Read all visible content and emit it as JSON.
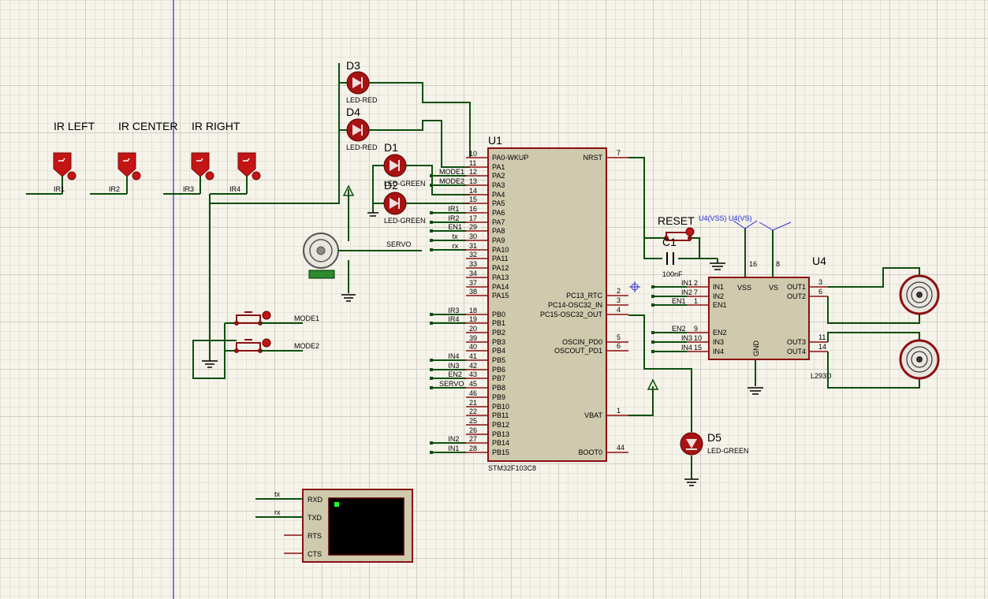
{
  "sensors": {
    "headers": [
      "IR LEFT",
      "IR CENTER",
      "IR RIGHT"
    ],
    "labels": [
      "IR1",
      "IR2",
      "IR3",
      "IR4"
    ]
  },
  "leds": {
    "d3": {
      "ref": "D3",
      "type": "LED-RED"
    },
    "d4": {
      "ref": "D4",
      "type": "LED-RED"
    },
    "d1": {
      "ref": "D1",
      "type": "LED-GREEN"
    },
    "d2": {
      "ref": "D2",
      "type": "LED-GREEN"
    },
    "d5": {
      "ref": "D5",
      "type": "LED-GREEN"
    }
  },
  "servo": {
    "net": "SERVO"
  },
  "buttons": {
    "mode1": "MODE1",
    "mode2": "MODE2",
    "reset": "RESET"
  },
  "mcu": {
    "ref": "U1",
    "part": "STM32F103C8",
    "left_pins": [
      {
        "num": "10",
        "name": "PA0-WKUP",
        "net": ""
      },
      {
        "num": "11",
        "name": "PA1",
        "net": ""
      },
      {
        "num": "12",
        "name": "PA2",
        "net": "MODE1"
      },
      {
        "num": "13",
        "name": "PA3",
        "net": "MODE2"
      },
      {
        "num": "14",
        "name": "PA4",
        "net": ""
      },
      {
        "num": "15",
        "name": "PA5",
        "net": ""
      },
      {
        "num": "16",
        "name": "PA6",
        "net": "IR1"
      },
      {
        "num": "17",
        "name": "PA7",
        "net": "IR2"
      },
      {
        "num": "29",
        "name": "PA8",
        "net": "EN1"
      },
      {
        "num": "30",
        "name": "PA9",
        "net": "tx"
      },
      {
        "num": "31",
        "name": "PA10",
        "net": "rx"
      },
      {
        "num": "32",
        "name": "PA11",
        "net": ""
      },
      {
        "num": "33",
        "name": "PA12",
        "net": ""
      },
      {
        "num": "34",
        "name": "PA13",
        "net": ""
      },
      {
        "num": "37",
        "name": "PA14",
        "net": ""
      },
      {
        "num": "38",
        "name": "PA15",
        "net": ""
      },
      {
        "num": "18",
        "name": "PB0",
        "net": "IR3"
      },
      {
        "num": "19",
        "name": "PB1",
        "net": "IR4"
      },
      {
        "num": "20",
        "name": "PB2",
        "net": ""
      },
      {
        "num": "39",
        "name": "PB3",
        "net": ""
      },
      {
        "num": "40",
        "name": "PB4",
        "net": ""
      },
      {
        "num": "41",
        "name": "PB5",
        "net": "IN4"
      },
      {
        "num": "42",
        "name": "PB6",
        "net": "IN3"
      },
      {
        "num": "43",
        "name": "PB7",
        "net": "EN2"
      },
      {
        "num": "45",
        "name": "PB8",
        "net": "SERVO"
      },
      {
        "num": "46",
        "name": "PB9",
        "net": ""
      },
      {
        "num": "21",
        "name": "PB10",
        "net": ""
      },
      {
        "num": "22",
        "name": "PB11",
        "net": ""
      },
      {
        "num": "25",
        "name": "PB12",
        "net": ""
      },
      {
        "num": "26",
        "name": "PB13",
        "net": ""
      },
      {
        "num": "27",
        "name": "PB14",
        "net": "IN2"
      },
      {
        "num": "28",
        "name": "PB15",
        "net": "IN1"
      }
    ],
    "right_pins": [
      {
        "num": "7",
        "name": "NRST"
      },
      {
        "num": "2",
        "name": "PC13_RTC"
      },
      {
        "num": "3",
        "name": "PC14-OSC32_IN"
      },
      {
        "num": "4",
        "name": "PC15-OSC32_OUT"
      },
      {
        "num": "5",
        "name": "OSCIN_PD0"
      },
      {
        "num": "6",
        "name": "OSCOUT_PD1"
      },
      {
        "num": "1",
        "name": "VBAT"
      },
      {
        "num": "44",
        "name": "BOOT0"
      }
    ]
  },
  "capacitor": {
    "ref": "C1",
    "value": "100nF"
  },
  "driver": {
    "ref": "U4",
    "part": "L293D",
    "power_labels": "U4(VSS)  U4(VS)",
    "vss_pin": "16",
    "vs_pin": "8",
    "vss": "VSS",
    "vs": "VS",
    "gnd": "GND",
    "left_pins": [
      {
        "num": "2",
        "name": "IN1",
        "net": "IN1"
      },
      {
        "num": "7",
        "name": "IN2",
        "net": "IN2"
      },
      {
        "num": "1",
        "name": "EN1",
        "net": "EN1"
      },
      {
        "num": "9",
        "name": "EN2",
        "net": "EN2"
      },
      {
        "num": "10",
        "name": "IN3",
        "net": "IN3"
      },
      {
        "num": "15",
        "name": "IN4",
        "net": "IN4"
      }
    ],
    "right_pins": [
      {
        "num": "3",
        "name": "OUT1"
      },
      {
        "num": "6",
        "name": "OUT2"
      },
      {
        "num": "11",
        "name": "OUT3"
      },
      {
        "num": "14",
        "name": "OUT4"
      }
    ]
  },
  "terminal": {
    "pins": [
      "RXD",
      "TXD",
      "RTS",
      "CTS"
    ],
    "nets": [
      "tx",
      "rx"
    ]
  },
  "colors": {
    "wire": "#0b4f0b",
    "component": "#8b1010",
    "body": "#cfc9ae",
    "grid": "#cfcdc4",
    "axis": "#2b2bc8"
  }
}
